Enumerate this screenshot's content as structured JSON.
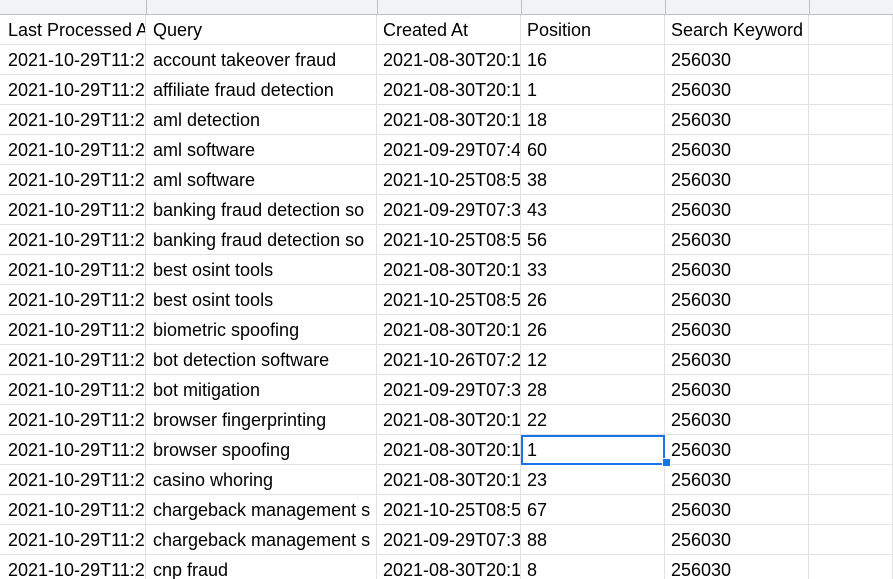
{
  "columns": [
    "Last Processed At",
    "Query",
    "Created At",
    "Position",
    "Search Keyword Mobile",
    ""
  ],
  "rows": [
    [
      "2021-10-29T11:2",
      "account takeover fraud",
      "2021-08-30T20:1",
      "16",
      "256030",
      ""
    ],
    [
      "2021-10-29T11:2",
      "affiliate fraud detection",
      "2021-08-30T20:1",
      "1",
      "256030",
      ""
    ],
    [
      "2021-10-29T11:2",
      "aml detection",
      "2021-08-30T20:1",
      "18",
      "256030",
      ""
    ],
    [
      "2021-10-29T11:2",
      "aml software",
      "2021-09-29T07:4",
      "60",
      "256030",
      ""
    ],
    [
      "2021-10-29T11:2",
      "aml software",
      "2021-10-25T08:5",
      "38",
      "256030",
      ""
    ],
    [
      "2021-10-29T11:2",
      "banking fraud detection so",
      "2021-09-29T07:3",
      "43",
      "256030",
      ""
    ],
    [
      "2021-10-29T11:2",
      "banking fraud detection so",
      "2021-10-25T08:5",
      "56",
      "256030",
      ""
    ],
    [
      "2021-10-29T11:2",
      "best osint tools",
      "2021-08-30T20:1",
      "33",
      "256030",
      ""
    ],
    [
      "2021-10-29T11:2",
      "best osint tools",
      "2021-10-25T08:5",
      "26",
      "256030",
      ""
    ],
    [
      "2021-10-29T11:2",
      "biometric spoofing",
      "2021-08-30T20:1",
      "26",
      "256030",
      ""
    ],
    [
      "2021-10-29T11:2",
      "bot detection software",
      "2021-10-26T07:2",
      "12",
      "256030",
      ""
    ],
    [
      "2021-10-29T11:2",
      "bot mitigation",
      "2021-09-29T07:3",
      "28",
      "256030",
      ""
    ],
    [
      "2021-10-29T11:2",
      "browser fingerprinting",
      "2021-08-30T20:1",
      "22",
      "256030",
      ""
    ],
    [
      "2021-10-29T11:2",
      "browser spoofing",
      "2021-08-30T20:1",
      "1",
      "256030",
      ""
    ],
    [
      "2021-10-29T11:2",
      "casino whoring",
      "2021-08-30T20:1",
      "23",
      "256030",
      ""
    ],
    [
      "2021-10-29T11:2",
      "chargeback management s",
      "2021-10-25T08:5",
      "67",
      "256030",
      ""
    ],
    [
      "2021-10-29T11:2",
      "chargeback management s",
      "2021-09-29T07:3",
      "88",
      "256030",
      ""
    ],
    [
      "2021-10-29T11:2",
      "cnp fraud",
      "2021-08-30T20:1",
      "8",
      "256030",
      ""
    ]
  ],
  "selected_cell": "D14",
  "colors": {
    "selection": "#1a73e8",
    "gridline": "#e2e2e2",
    "header_strip": "#f1f3f4"
  }
}
